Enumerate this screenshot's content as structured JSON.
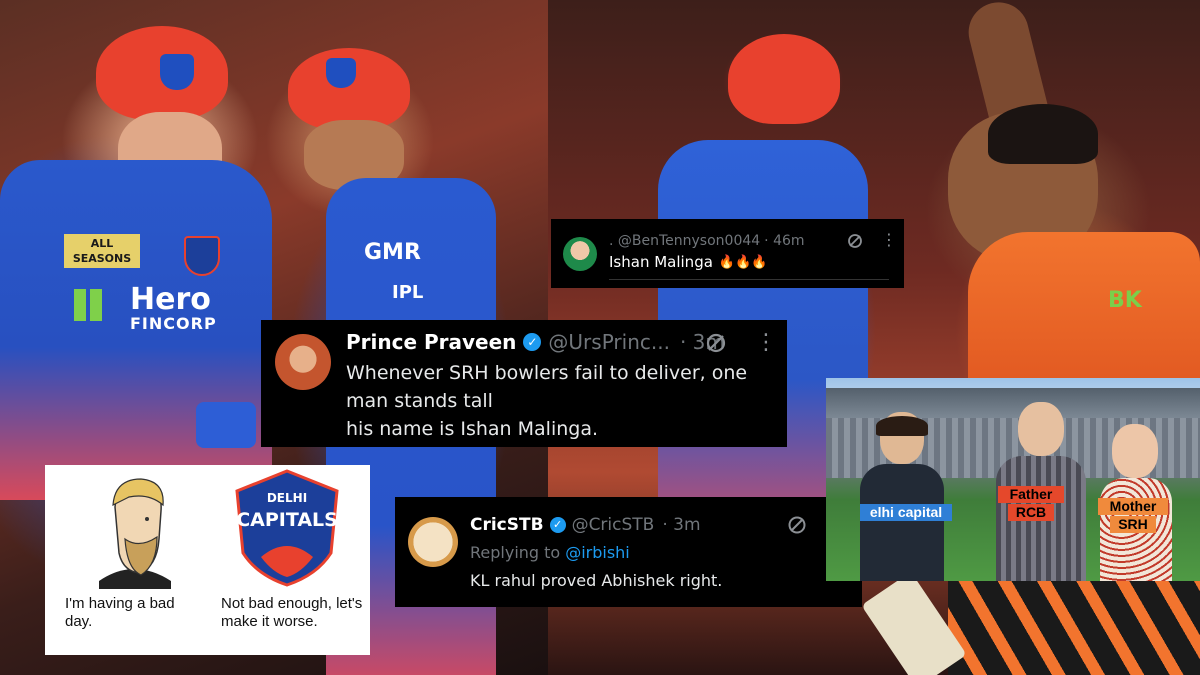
{
  "photo_left": {
    "helmet_badge_1": "DELHI CAPITALS",
    "helmet_badge_2": "DELHI CAPITALS",
    "sponsor_1": "ALL SEASONS",
    "sponsor_2": "Hero",
    "sponsor_2b": "FINCORP",
    "sponsor_3": "GMR",
    "league_logo": "IPL"
  },
  "photo_right": {
    "sponsor_right": "BK"
  },
  "tweet_top": {
    "handle": ". @BenTennyson0044",
    "time": "· 46m",
    "text": "Ishan Malinga",
    "emoji": "🔥🔥🔥"
  },
  "tweet_main": {
    "name": "Prince Praveen",
    "handle": "@UrsPrinc...",
    "time": "· 3m",
    "line1": "Whenever SRH bowlers fail to deliver, one",
    "line2": "man stands tall",
    "line3_prefix": "his name is",
    "line3_name": "Ishan Malinga."
  },
  "tweet_bottom": {
    "name": "CricSTB",
    "handle": "@CricSTB",
    "time": "· 3m",
    "reply_prefix": "Replying to",
    "reply_handle": "@irbishi",
    "text_prefix": "KL rahul",
    "text_suffix": "proved Abhishek right."
  },
  "meme_left": {
    "left_caption": "I'm having a bad day.",
    "logo_top": "DELHI",
    "logo_main": "CAPITALS",
    "right_caption": "Not bad enough, let's make it worse."
  },
  "meme_right": {
    "tag_1": "elhi capital",
    "tag_2a": "Father",
    "tag_2b": "RCB",
    "tag_3a": "Mother",
    "tag_3b": "SRH"
  },
  "colors": {
    "tweet_bg": "#000000",
    "verified": "#1d9bf0",
    "link": "#1d9bf0",
    "dc_blue": "#1f4fbf",
    "dc_red": "#e8412e",
    "tag_red": "#e5482b",
    "tag_orange": "#f08a3c",
    "tag_blue": "#2f7fd6"
  }
}
